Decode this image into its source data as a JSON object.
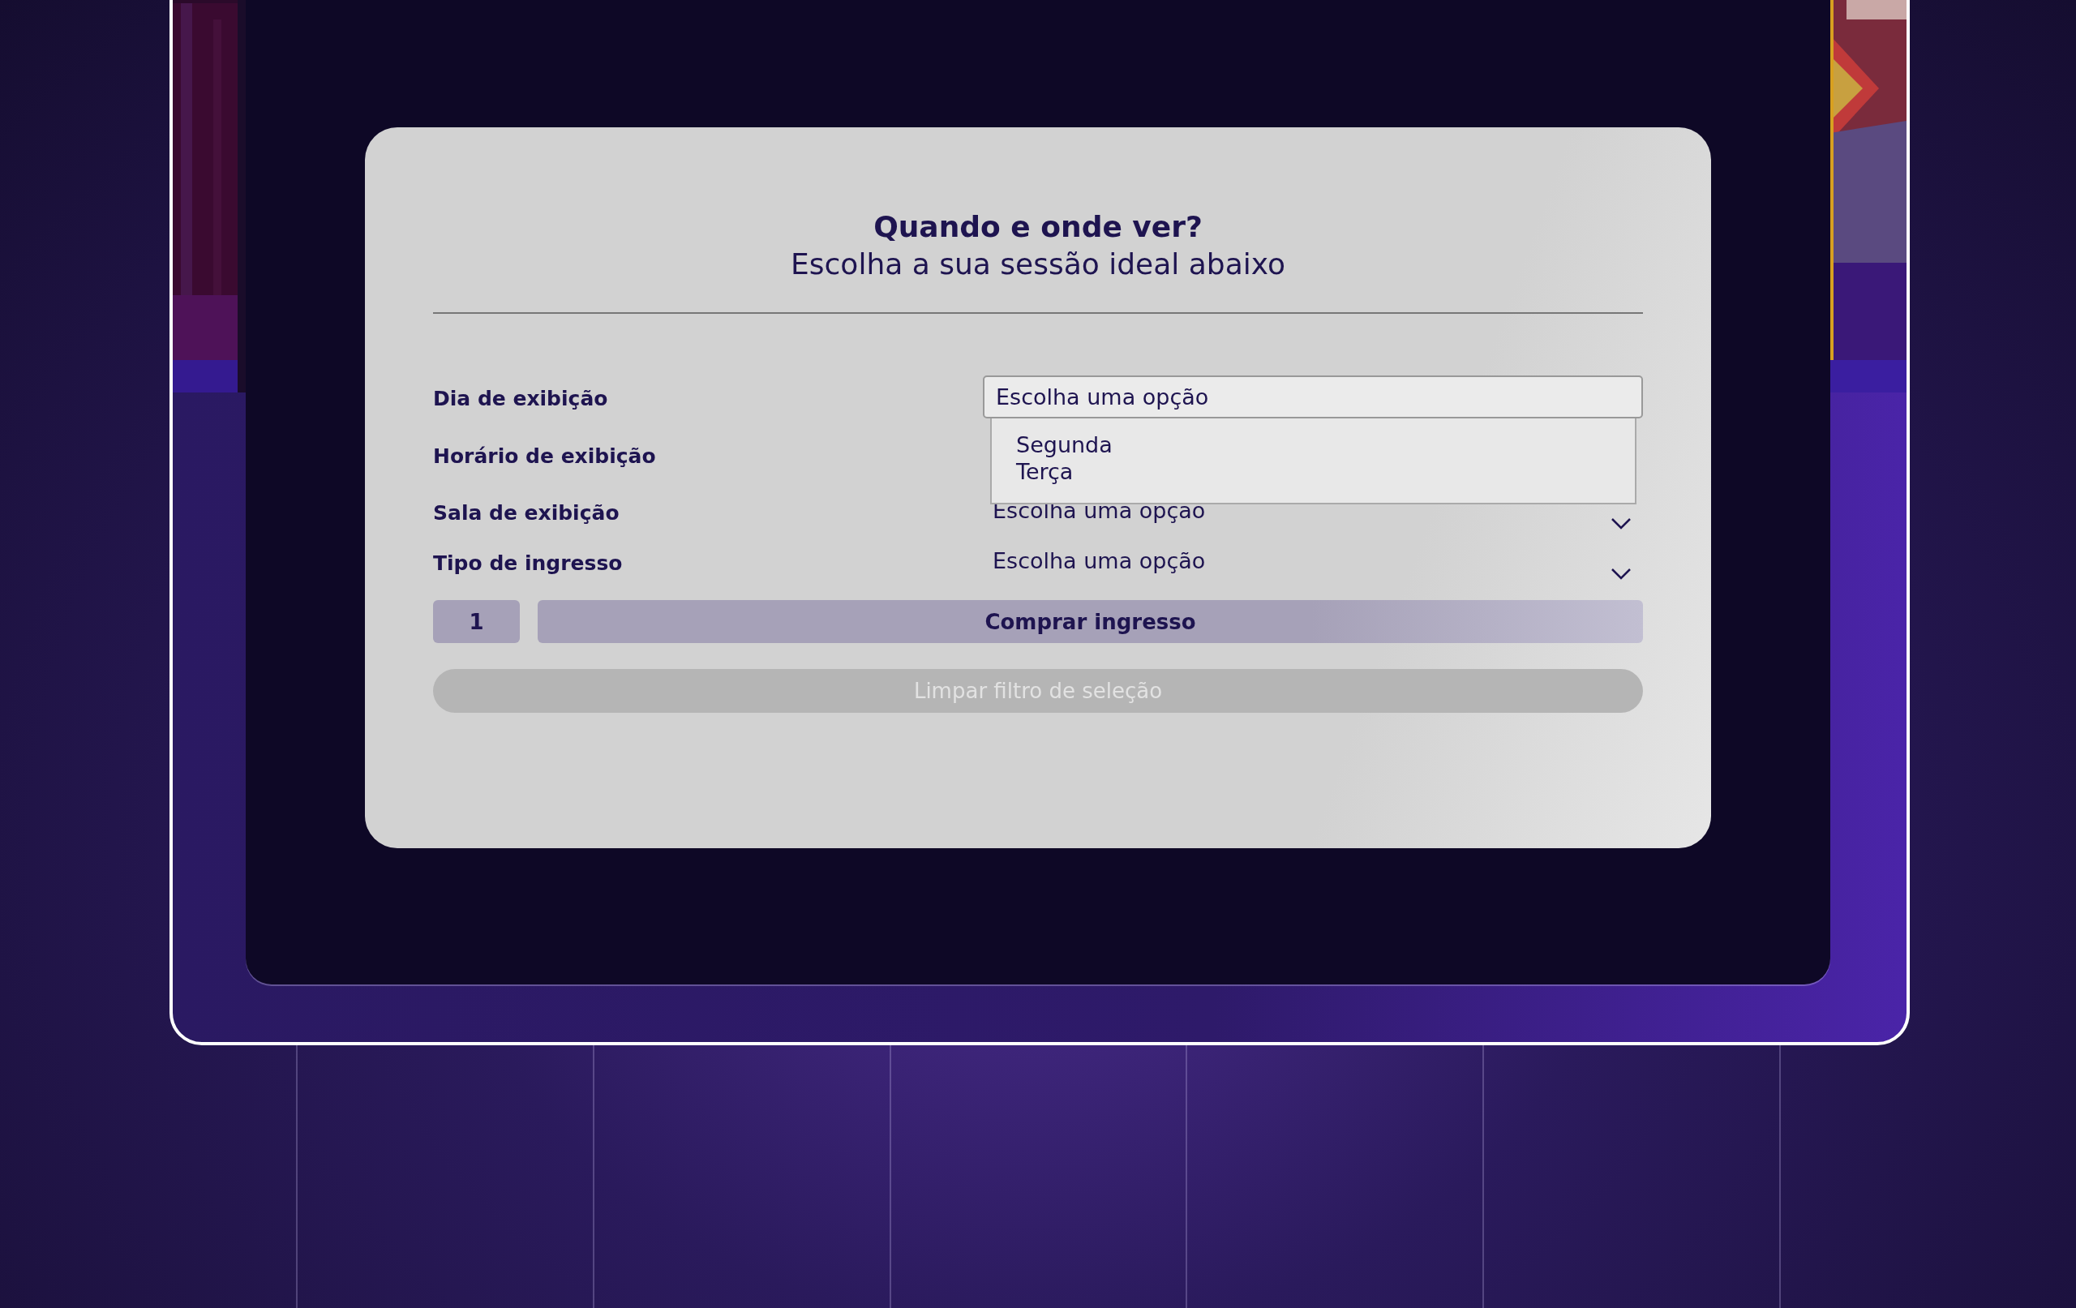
{
  "card": {
    "title": "Quando e onde ver?",
    "subtitle": "Escolha a sua sessão ideal abaixo"
  },
  "fields": [
    {
      "label": "Dia de exibição",
      "value": "Escolha uma opção",
      "expanded": true,
      "options": [
        "Segunda",
        "Terça"
      ]
    },
    {
      "label": "Horário de exibição",
      "expanded": false
    },
    {
      "label": "Sala de exibição",
      "value": "Escolha uma opção",
      "expanded": false
    },
    {
      "label": "Tipo de ingresso",
      "value": "Escolha uma opção",
      "expanded": false
    }
  ],
  "quantity": "1",
  "buy_button": {
    "label": "Comprar ingresso"
  },
  "clear_button": {
    "label": "Limpar filtro de seleção",
    "disabled": true
  }
}
